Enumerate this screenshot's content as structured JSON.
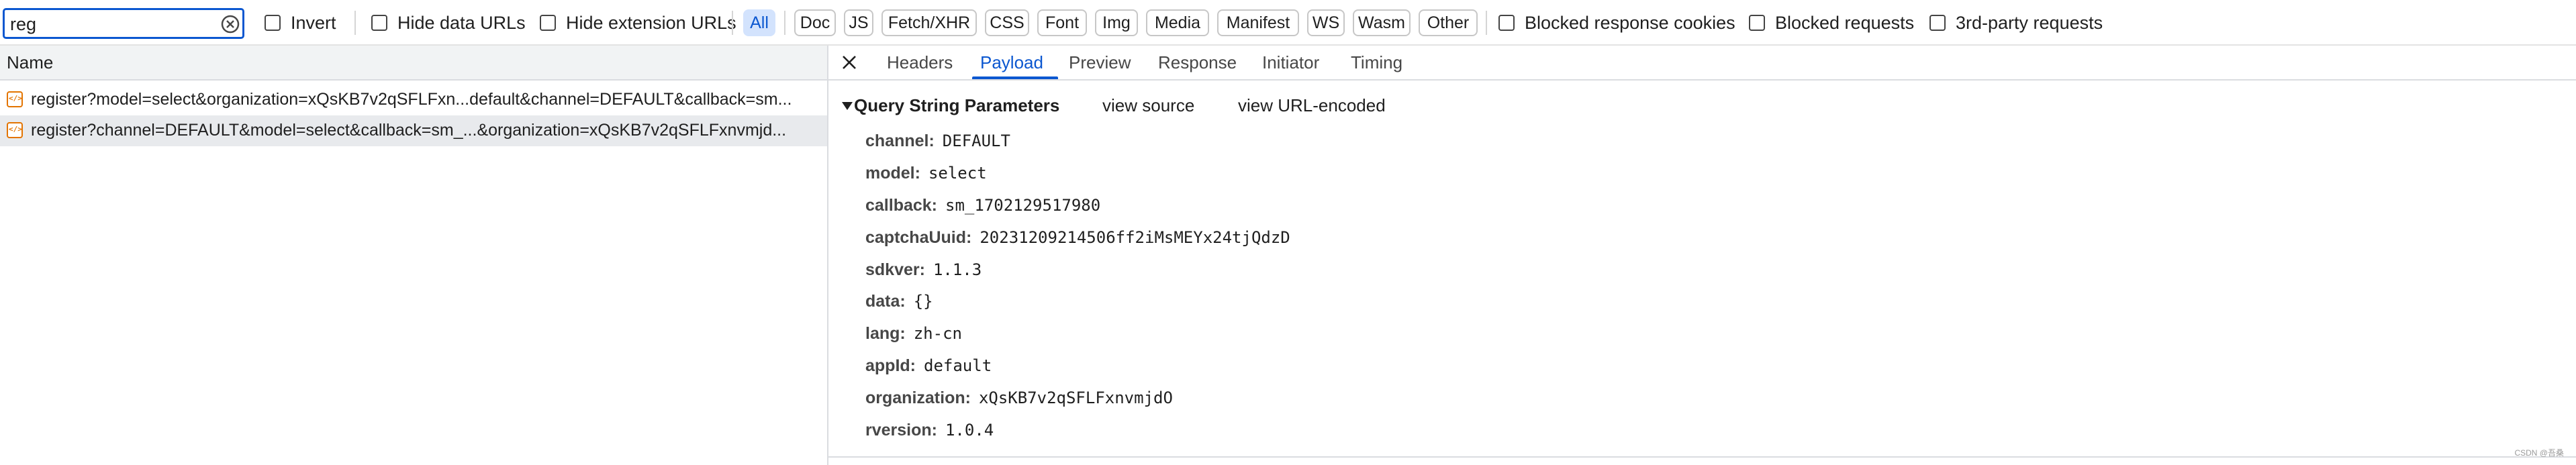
{
  "search": {
    "value": "reg"
  },
  "filters": {
    "invert": "Invert",
    "hide_data_urls": "Hide data URLs",
    "hide_extension_urls": "Hide extension URLs",
    "types": [
      "All",
      "Doc",
      "JS",
      "Fetch/XHR",
      "CSS",
      "Font",
      "Img",
      "Media",
      "Manifest",
      "WS",
      "Wasm",
      "Other"
    ],
    "active_type": "All",
    "blocked_response_cookies": "Blocked response cookies",
    "blocked_requests": "Blocked requests",
    "third_party_requests": "3rd-party requests"
  },
  "request_list": {
    "header": "Name",
    "rows": [
      "register?model=select&organization=xQsKB7v2qSFLFxn...default&channel=DEFAULT&callback=sm...",
      "register?channel=DEFAULT&model=select&callback=sm_...&organization=xQsKB7v2qSFLFxnvmjd..."
    ]
  },
  "detail": {
    "tabs": [
      "Headers",
      "Payload",
      "Preview",
      "Response",
      "Initiator",
      "Timing"
    ],
    "active_tab": "Payload",
    "section_title": "Query String Parameters",
    "view_source": "view source",
    "view_url_encoded": "view URL-encoded",
    "params": [
      {
        "key": "channel:",
        "value": "DEFAULT"
      },
      {
        "key": "model:",
        "value": "select"
      },
      {
        "key": "callback:",
        "value": "sm_1702129517980"
      },
      {
        "key": "captchaUuid:",
        "value": "20231209214506ff2iMsMEYx24tjQdzD"
      },
      {
        "key": "sdkver:",
        "value": "1.1.3"
      },
      {
        "key": "data:",
        "value": "{}"
      },
      {
        "key": "lang:",
        "value": "zh-cn"
      },
      {
        "key": "appId:",
        "value": "default"
      },
      {
        "key": "organization:",
        "value": "xQsKB7v2qSFLFxnvmjdO"
      },
      {
        "key": "rversion:",
        "value": "1.0.4"
      }
    ]
  },
  "watermark": "CSDN @吾桑",
  "colors": {
    "accent": "#0b57d0",
    "active_chip_bg": "#d3e3fd",
    "selected_row": "#e8eaed",
    "script_icon": "#e37400"
  },
  "icons": {
    "clear": "clear-circle-icon",
    "close": "close-icon",
    "expand": "triangle-down-icon",
    "request": "script-file-icon"
  }
}
